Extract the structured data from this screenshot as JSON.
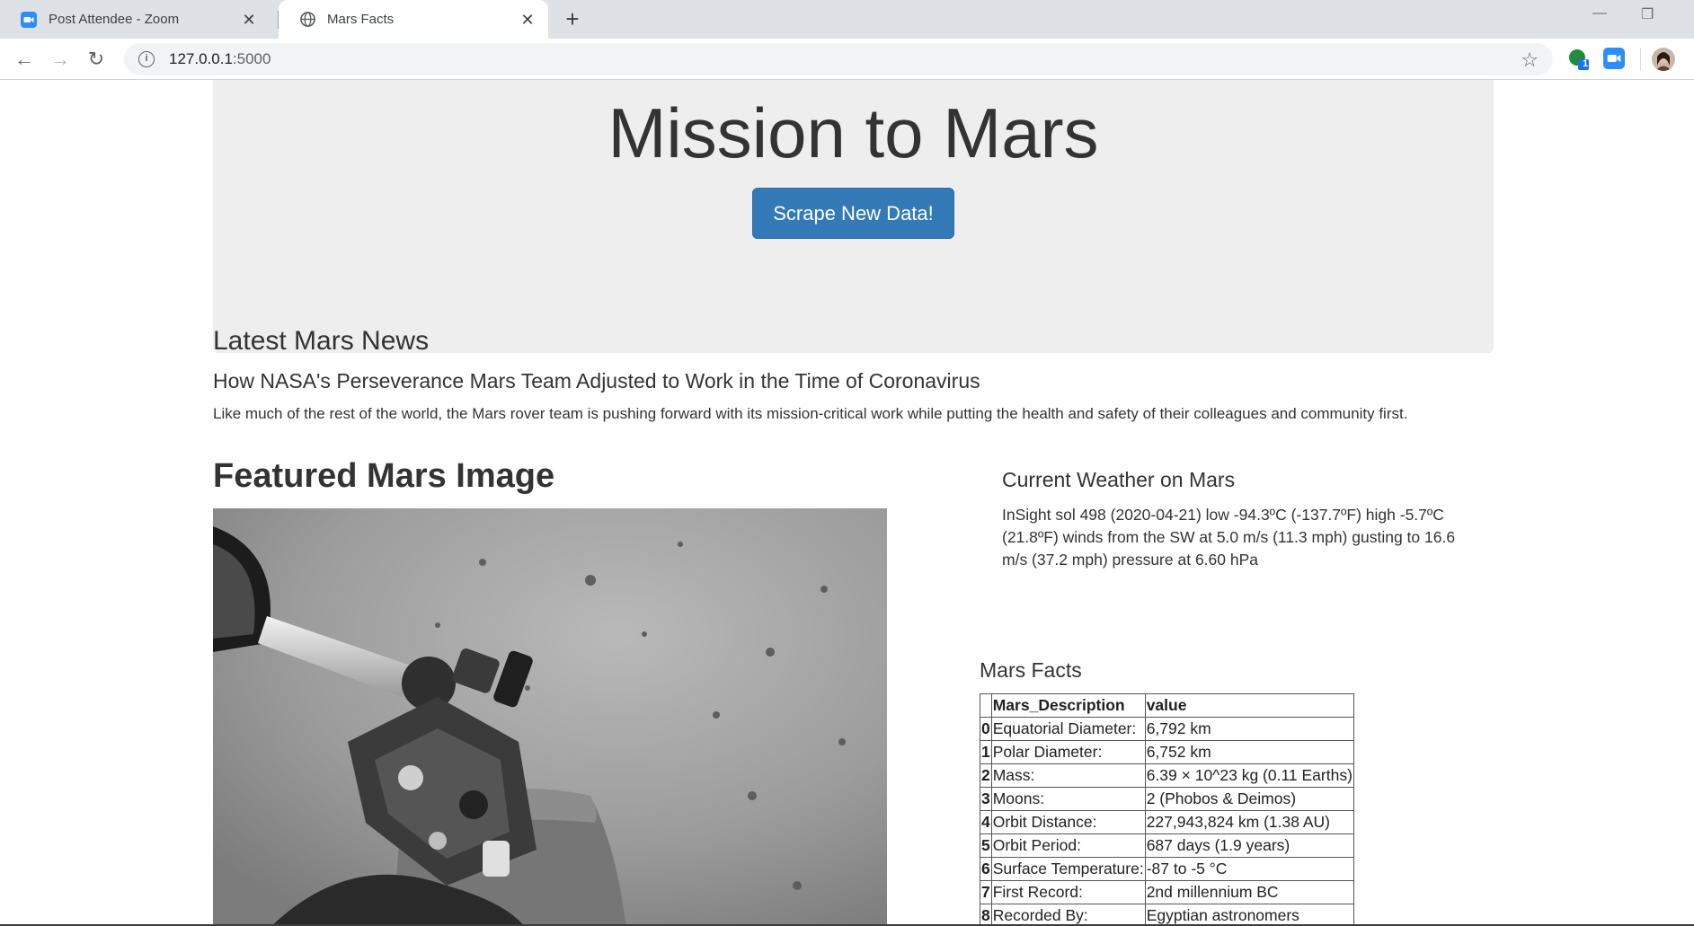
{
  "browser": {
    "tabs": [
      {
        "title": "Post Attendee - Zoom",
        "icon": "zoom-icon",
        "active": false
      },
      {
        "title": "Mars Facts",
        "icon": "globe-icon",
        "active": true
      }
    ],
    "url_host": "127.0.0.1",
    "url_port": ":5000",
    "zoom_badge_count": "1"
  },
  "jumbotron": {
    "title": "Mission to Mars",
    "button_label": "Scrape New Data!"
  },
  "news": {
    "heading": "Latest Mars News",
    "title": "How NASA's Perseverance Mars Team Adjusted to Work in the Time of Coronavirus",
    "paragraph": "Like much of the rest of the world, the Mars rover team is pushing forward with its mission-critical work while putting the health and safety of their colleagues and community first."
  },
  "featured": {
    "heading": "Featured Mars Image"
  },
  "weather": {
    "heading": "Current Weather on Mars",
    "text": "InSight sol 498 (2020-04-21) low -94.3ºC (-137.7ºF) high -5.7ºC (21.8ºF) winds from the SW at 5.0 m/s (11.3 mph) gusting to 16.6 m/s (37.2 mph) pressure at 6.60 hPa"
  },
  "facts": {
    "heading": "Mars Facts",
    "columns": [
      "Mars_Description",
      "value"
    ],
    "rows": [
      {
        "index": "0",
        "desc": "Equatorial Diameter:",
        "value": "6,792 km"
      },
      {
        "index": "1",
        "desc": "Polar Diameter:",
        "value": "6,752 km"
      },
      {
        "index": "2",
        "desc": "Mass:",
        "value": "6.39 × 10^23 kg (0.11 Earths)"
      },
      {
        "index": "3",
        "desc": "Moons:",
        "value": "2 (Phobos & Deimos)"
      },
      {
        "index": "4",
        "desc": "Orbit Distance:",
        "value": "227,943,824 km (1.38 AU)"
      },
      {
        "index": "5",
        "desc": "Orbit Period:",
        "value": "687 days (1.9 years)"
      },
      {
        "index": "6",
        "desc": "Surface Temperature:",
        "value": "-87 to -5 °C"
      },
      {
        "index": "7",
        "desc": "First Record:",
        "value": "2nd millennium BC"
      },
      {
        "index": "8",
        "desc": "Recorded By:",
        "value": "Egyptian astronomers"
      }
    ]
  },
  "colors": {
    "accent": "#337ab7",
    "jumbotron_bg": "#eeeeee",
    "tabstrip_bg": "#dee1e6"
  }
}
